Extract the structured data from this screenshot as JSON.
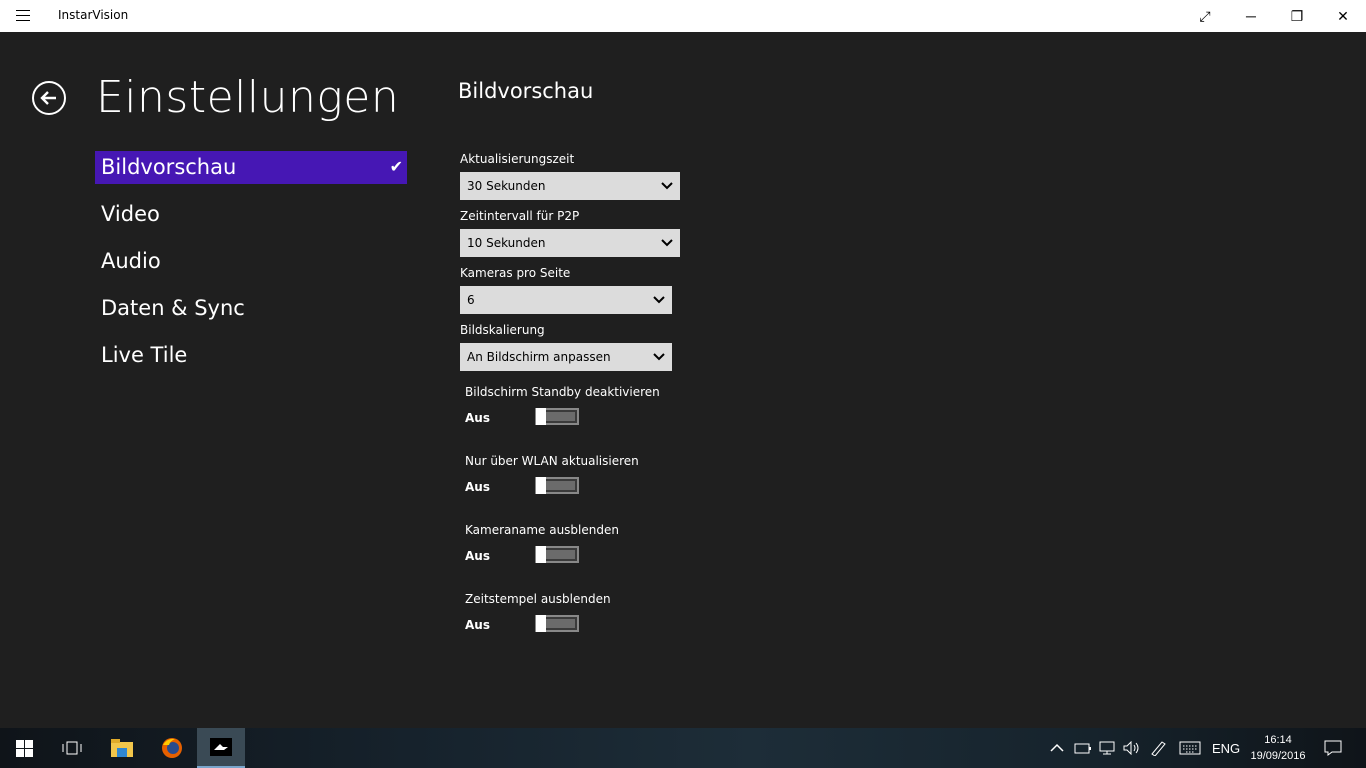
{
  "window": {
    "title": "InstarVision"
  },
  "page": {
    "heading": "Einstellungen"
  },
  "categories": [
    {
      "label": "Bildvorschau",
      "selected": true
    },
    {
      "label": "Video"
    },
    {
      "label": "Audio"
    },
    {
      "label": "Daten & Sync"
    },
    {
      "label": "Live Tile"
    }
  ],
  "section": {
    "title": "Bildvorschau",
    "selects": [
      {
        "label": "Aktualisierungszeit",
        "value": "30 Sekunden"
      },
      {
        "label": "Zeitintervall für P2P",
        "value": "10 Sekunden"
      },
      {
        "label": "Kameras pro Seite",
        "value": "6"
      },
      {
        "label": "Bildskalierung",
        "value": "An Bildschirm anpassen"
      }
    ],
    "toggles": [
      {
        "label": "Bildschirm Standby deaktivieren",
        "state": "Aus"
      },
      {
        "label": "Nur über WLAN aktualisieren",
        "state": "Aus"
      },
      {
        "label": "Kameraname ausblenden",
        "state": "Aus"
      },
      {
        "label": "Zeitstempel ausblenden",
        "state": "Aus"
      }
    ]
  },
  "taskbar": {
    "language": "ENG",
    "time": "16:14",
    "date": "19/09/2016"
  },
  "icons": {
    "menu": "hamburger-icon",
    "fullscreen": "expand-icon",
    "minimize": "minimize-icon",
    "restore": "restore-icon",
    "close": "close-icon",
    "back": "back-arrow-icon",
    "check": "checkmark-icon",
    "chevron": "chevron-down-icon"
  },
  "colors": {
    "accent": "#4617b4",
    "background": "#1f1f1f"
  }
}
